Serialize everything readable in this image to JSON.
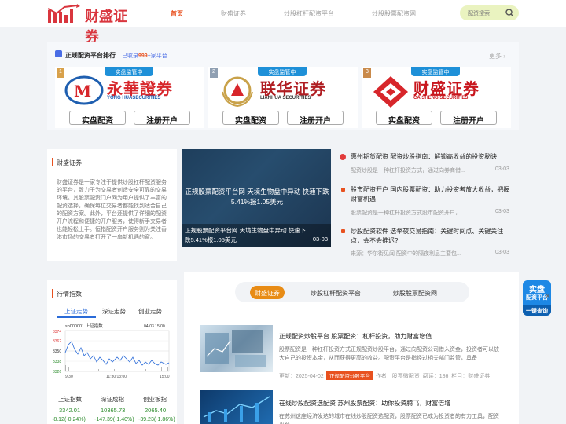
{
  "header": {
    "logo_text": "财盛证券",
    "nav": [
      "首页",
      "财盛证券",
      "炒股杠杆配资平台",
      "炒股股票配资网"
    ],
    "search_placeholder": "配资搜索"
  },
  "ranking": {
    "title": "正规配资平台排行",
    "subtitle_prefix": "已收录",
    "subtitle_count": "999",
    "subtitle_suffix": "+家平台",
    "more": "更多",
    "cards": [
      {
        "rank": "1",
        "tag": "实盘监管中",
        "name": "永華證券",
        "en": "YONG HUASECURITIES",
        "btn1": "实盘配资",
        "btn2": "注册开户"
      },
      {
        "rank": "2",
        "tag": "实盘监管中",
        "name": "联华证券",
        "en": "LIANHUA SECURITIES",
        "btn1": "实盘配资",
        "btn2": "注册开户"
      },
      {
        "rank": "3",
        "tag": "实盘监管中",
        "name": "财盛证券",
        "en": "CAISHENG SECURITIES",
        "btn1": "实盘配资",
        "btn2": "注册开户"
      }
    ]
  },
  "about": {
    "title": "财盛证券",
    "text": "财盛证券是一家专注于提供炒股杠杆配资服务的平台，致力于为交易者创造安全可靠的交易环境。其股票配资门户网为用户提供了丰富的配资选择，确保每位交易者都能找到适合自己的配资方案。此外，平台还提供了详细的配资开户流程和便捷的开户服务，使得新手交易者也能轻松上手。恒指配资开户服务则为关注香港市场的交易者打开了一扇新机遇的窗。"
  },
  "slider": {
    "big_text": "正规股票配资平台网 天境生物盘中异动 快速下跌5.41%报1.05美元",
    "caption": "正规股票配资平台网 天境生物盘中异动 快速下跌5.41%报1.05美元",
    "date": "03-03"
  },
  "news": [
    {
      "title": "惠州期货配资 配资炒股指南：解锁高收益的投资秘诀",
      "desc": "配资炒股是一种杠杆投资方式，通过向券商借...",
      "date": "03-03"
    },
    {
      "title": "股市配资开户 国内股票配资：助力投资者放大收益，把握财富机遇",
      "desc": "股票配资是一种杠杆投资方式股市配资开户，...",
      "date": "03-03"
    },
    {
      "title": "炒股配资软件 选举夜交易指南：关键时间点、关键关注点，会不会推迟?",
      "desc": "来源：华尔街见闻 配资中的隔夜利息主要包...",
      "date": "03-03"
    }
  ],
  "market": {
    "title": "行情指数",
    "tabs": [
      "上证走势",
      "深证走势",
      "创业走势"
    ],
    "chart_label": "sh000001  上证指数",
    "chart_time": "04-03 15:00",
    "y_ticks": [
      "3374",
      "3362",
      "3350",
      "3338",
      "3326"
    ],
    "x_ticks": [
      "9:30",
      "11:30/13:00",
      "15:00"
    ],
    "indices": [
      {
        "name": "上证指数",
        "value": "3342.01",
        "change": "-8.12(-0.24%)"
      },
      {
        "name": "深证成指",
        "value": "10365.73",
        "change": "-147.39(-1.40%)"
      },
      {
        "name": "创业板指",
        "value": "2065.40",
        "change": "-39.23(-1.86%)"
      }
    ]
  },
  "articles": {
    "tabs": [
      "财盛证券",
      "炒股杠杆配资平台",
      "炒股股票配资网"
    ],
    "items": [
      {
        "title": "正规配资炒股平台 股票配资：杠杆投资，助力财富增值",
        "body": "股票配资是一种杠杆投资方式正规配资炒股平台，通过向配资公司借入资金，投资者可以放大自己的投资本金，从而获得更高的收益。配资平台是指经过相关部门监管，具备",
        "date_prefix": "更新：2025-04-02",
        "tag": "正规配资炒股平台",
        "author": "作者：股票微配资",
        "reads": "阅读：186",
        "column": "栏目：财盛证券"
      },
      {
        "title": "在线炒股配资选配资 苏州股票配资：助你投资腾飞，财富倍增",
        "body": "在苏州这座经济发达的城市在线炒股配资选配资，股票配资已成为投资者的有力工具，配资平台",
        "date_prefix": "",
        "tag": "",
        "author": "",
        "reads": "",
        "column": ""
      }
    ]
  },
  "float_badge": {
    "line1": "实盘",
    "line2": "配资平台",
    "line3": "一键查询",
    "close": "✕"
  }
}
